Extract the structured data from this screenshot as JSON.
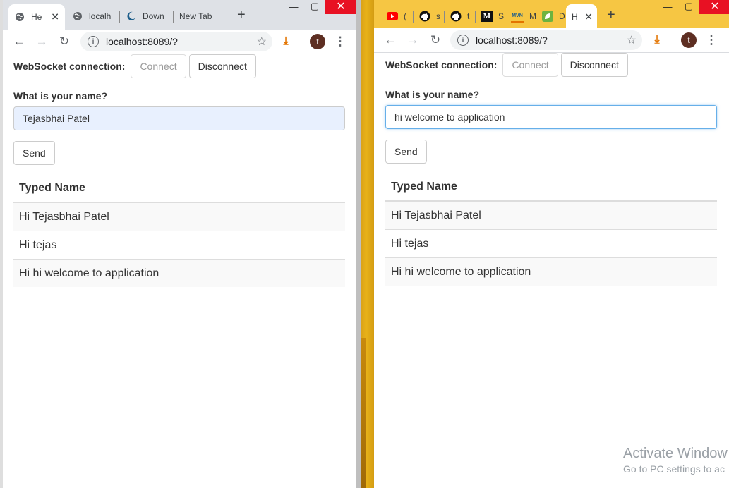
{
  "left": {
    "tabs": [
      {
        "label": "He",
        "favicon": "globe-icon",
        "active": true
      },
      {
        "label": "localh",
        "favicon": "globe-icon",
        "active": false
      },
      {
        "label": "Down",
        "favicon": "crescent-icon",
        "active": false
      },
      {
        "label": "New Tab",
        "favicon": "",
        "active": false
      }
    ],
    "url": "localhost:8089/?",
    "avatar_letter": "t",
    "ws_label": "WebSocket connection:",
    "connect_label": "Connect",
    "disconnect_label": "Disconnect",
    "question": "What is your name?",
    "input_value": "Tejasbhai Patel",
    "send_label": "Send",
    "table_header": "Typed Name",
    "rows": [
      "Hi Tejasbhai Patel",
      "Hi tejas",
      "Hi hi welcome to application"
    ]
  },
  "right": {
    "tabs": [
      {
        "label": "(",
        "favicon": "youtube-icon"
      },
      {
        "label": "s",
        "favicon": "github-icon"
      },
      {
        "label": "t",
        "favicon": "github-icon"
      },
      {
        "label": "S",
        "favicon": "medium-icon"
      },
      {
        "label": "M",
        "favicon": "mvn-icon"
      },
      {
        "label": "D",
        "favicon": "spring-leaf-icon"
      },
      {
        "label": "H",
        "favicon": "",
        "active": true
      }
    ],
    "url": "localhost:8089/?",
    "avatar_letter": "t",
    "ws_label": "WebSocket connection:",
    "connect_label": "Connect",
    "disconnect_label": "Disconnect",
    "question": "What is your name?",
    "input_value": "hi welcome to application",
    "send_label": "Send",
    "table_header": "Typed Name",
    "rows": [
      "Hi Tejasbhai Patel",
      "Hi tejas",
      "Hi hi welcome to application"
    ]
  },
  "watermark": {
    "line1": "Activate Window",
    "line2": "Go to PC settings to ac"
  },
  "colors": {
    "left_tabstrip": "#dee1e6",
    "right_tabstrip": "#f6c643",
    "input_autofill_bg": "#e8f0fe",
    "input_focus_border": "#66afe9",
    "close_red": "#e81123"
  }
}
